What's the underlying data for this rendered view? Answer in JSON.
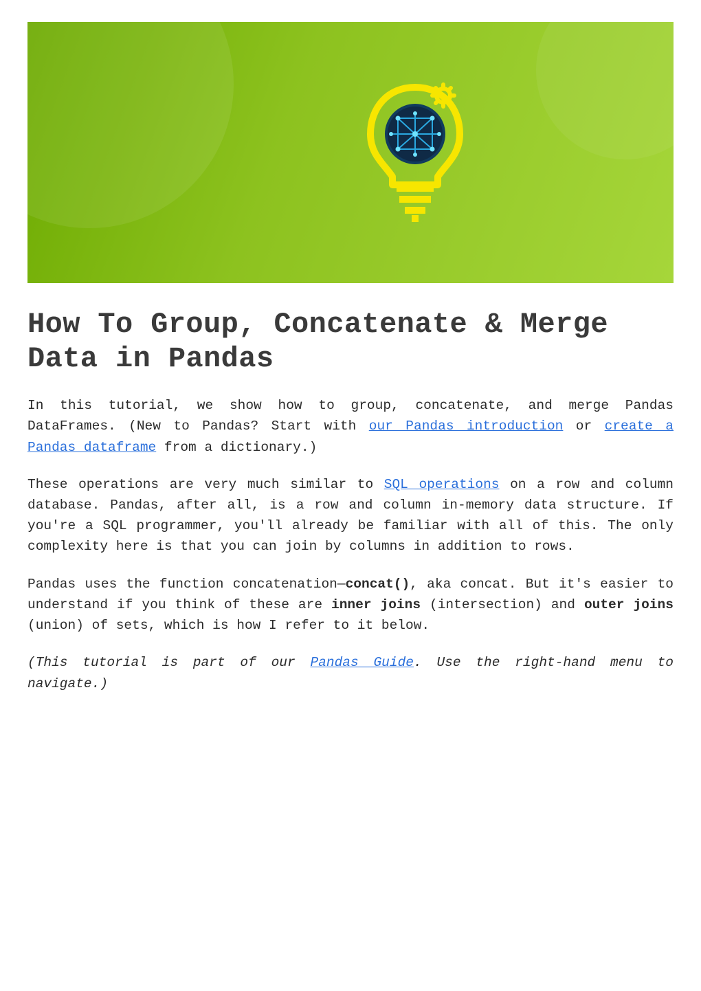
{
  "hero": {
    "icon_name": "lightbulb-brain-gear-icon"
  },
  "article": {
    "title": "How To Group, Concatenate & Merge Data in Pandas",
    "paragraphs": {
      "p1_lead": "In this tutorial, we show how to group, concatenate, and merge Pandas DataFrames. (New to Pandas? Start with ",
      "p1_link1": "our Pandas introduction",
      "p1_mid1": " or ",
      "p1_link2": "create a Pandas dataframe",
      "p1_tail": " from a dictionary.)",
      "p2_lead": "These operations are very much similar to ",
      "p2_link1": "SQL operations",
      "p2_tail": " on a row and column database. Pandas, after all, is a row and column in-memory data structure. If you're a SQL programmer, you'll already be familiar with all of this. The only complexity here is that you can join by columns in addition to rows.",
      "p3_lead": "Pandas uses the function concatenation—",
      "p3_bold1": "concat()",
      "p3_mid1": ", aka concat. But it's easier to understand if you think of these are ",
      "p3_bold2": "inner joins",
      "p3_mid2": " (intersection) and ",
      "p3_bold3": "outer joins",
      "p3_tail": " (union) of sets, which is how I refer to it below.",
      "p4_italic_lead": "(This tutorial is part of our ",
      "p4_link1": "Pandas Guide",
      "p4_italic_tail": ". Use the right-hand menu to navigate.)"
    }
  }
}
